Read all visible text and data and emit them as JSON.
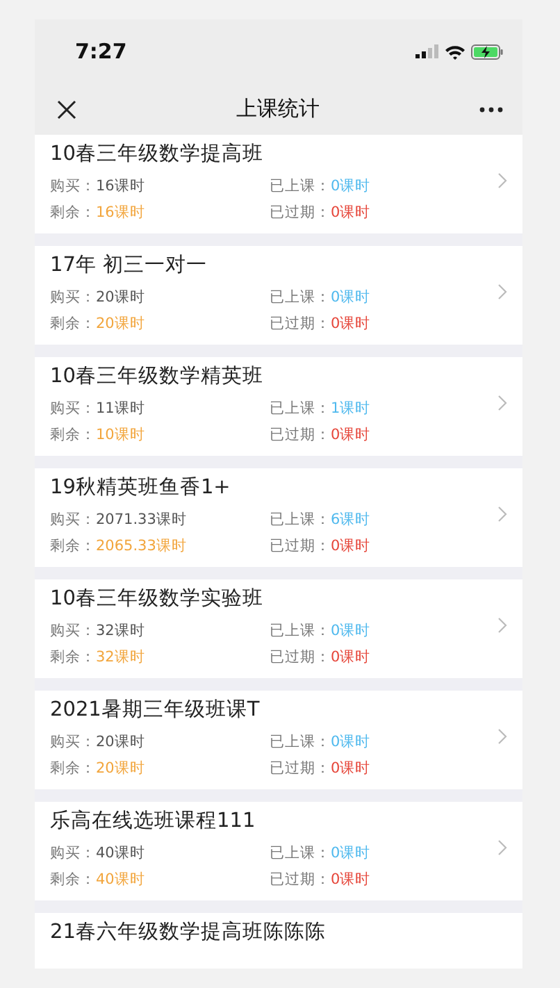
{
  "status_bar": {
    "time": "7:27"
  },
  "nav": {
    "title": "上课统计"
  },
  "courses": [
    {
      "title": "10春三年级数学提高班",
      "stats": [
        {
          "label": "购买：",
          "value": "16课时",
          "kind": "plain"
        },
        {
          "label": "已上课：",
          "value": "0课时",
          "kind": "attended"
        },
        {
          "label": "剩余：",
          "value": "16课时",
          "kind": "remaining"
        },
        {
          "label": "已过期：",
          "value": "0课时",
          "kind": "expired"
        }
      ]
    },
    {
      "title": "17年 初三一对一",
      "stats": [
        {
          "label": "购买：",
          "value": "20课时",
          "kind": "plain"
        },
        {
          "label": "已上课：",
          "value": "0课时",
          "kind": "attended"
        },
        {
          "label": "剩余：",
          "value": "20课时",
          "kind": "remaining"
        },
        {
          "label": "已过期：",
          "value": "0课时",
          "kind": "expired"
        }
      ]
    },
    {
      "title": "10春三年级数学精英班",
      "stats": [
        {
          "label": "购买：",
          "value": "11课时",
          "kind": "plain"
        },
        {
          "label": "已上课：",
          "value": "1课时",
          "kind": "attended"
        },
        {
          "label": "剩余：",
          "value": "10课时",
          "kind": "remaining"
        },
        {
          "label": "已过期：",
          "value": "0课时",
          "kind": "expired"
        }
      ]
    },
    {
      "title": "19秋精英班鱼香1+",
      "stats": [
        {
          "label": "购买：",
          "value": "2071.33课时",
          "kind": "plain"
        },
        {
          "label": "已上课：",
          "value": "6课时",
          "kind": "attended"
        },
        {
          "label": "剩余：",
          "value": "2065.33课时",
          "kind": "remaining"
        },
        {
          "label": "已过期：",
          "value": "0课时",
          "kind": "expired"
        }
      ]
    },
    {
      "title": "10春三年级数学实验班",
      "stats": [
        {
          "label": "购买：",
          "value": "32课时",
          "kind": "plain"
        },
        {
          "label": "已上课：",
          "value": "0课时",
          "kind": "attended"
        },
        {
          "label": "剩余：",
          "value": "32课时",
          "kind": "remaining"
        },
        {
          "label": "已过期：",
          "value": "0课时",
          "kind": "expired"
        }
      ]
    },
    {
      "title": "2021暑期三年级班课T",
      "stats": [
        {
          "label": "购买：",
          "value": "20课时",
          "kind": "plain"
        },
        {
          "label": "已上课：",
          "value": "0课时",
          "kind": "attended"
        },
        {
          "label": "剩余：",
          "value": "20课时",
          "kind": "remaining"
        },
        {
          "label": "已过期：",
          "value": "0课时",
          "kind": "expired"
        }
      ]
    },
    {
      "title": "乐高在线选班课程111",
      "stats": [
        {
          "label": "购买：",
          "value": "40课时",
          "kind": "plain"
        },
        {
          "label": "已上课：",
          "value": "0课时",
          "kind": "attended"
        },
        {
          "label": "剩余：",
          "value": "40课时",
          "kind": "remaining"
        },
        {
          "label": "已过期：",
          "value": "0课时",
          "kind": "expired"
        }
      ]
    },
    {
      "title": "21春六年级数学提高班陈陈陈"
    }
  ]
}
